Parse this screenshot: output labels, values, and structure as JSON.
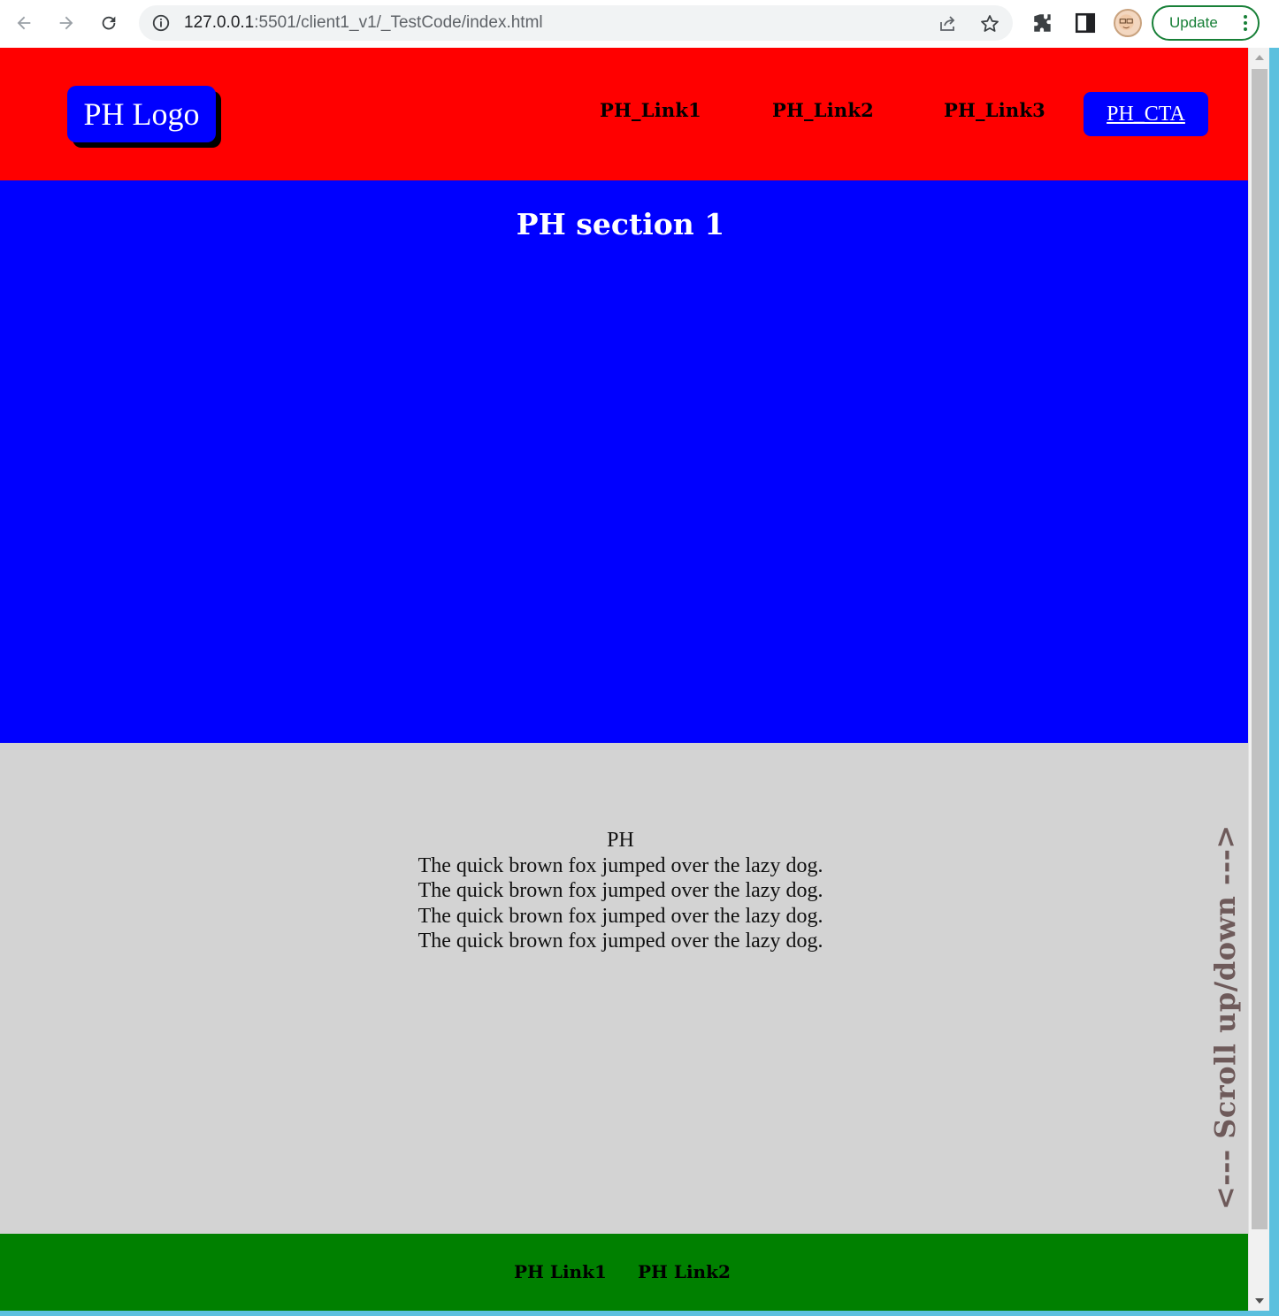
{
  "browser": {
    "url_host": "127.0.0.1",
    "url_rest": ":5501/client1_v1/_TestCode/index.html",
    "update_label": "Update"
  },
  "header": {
    "logo": "PH Logo",
    "links": [
      "PH_Link1",
      "PH_Link2",
      "PH_Link3"
    ],
    "cta": "PH_CTA"
  },
  "section1": {
    "title": "PH section 1"
  },
  "section2": {
    "heading": "PH",
    "lines": [
      "The quick brown fox jumped over the lazy dog.",
      "The quick brown fox jumped over the lazy dog.",
      "The quick brown fox jumped over the lazy dog.",
      "The quick brown fox jumped over the lazy dog."
    ]
  },
  "scroll_hint": "<--- Scroll up/down --->",
  "footer": {
    "links": [
      "PH Link1",
      "PH Link2"
    ]
  },
  "colors": {
    "header_bg": "#ff0000",
    "logo_bg": "#0000ff",
    "section1_bg": "#0000ff",
    "section2_bg": "#d3d3d3",
    "footer_bg": "#008000",
    "update_accent": "#188038"
  }
}
